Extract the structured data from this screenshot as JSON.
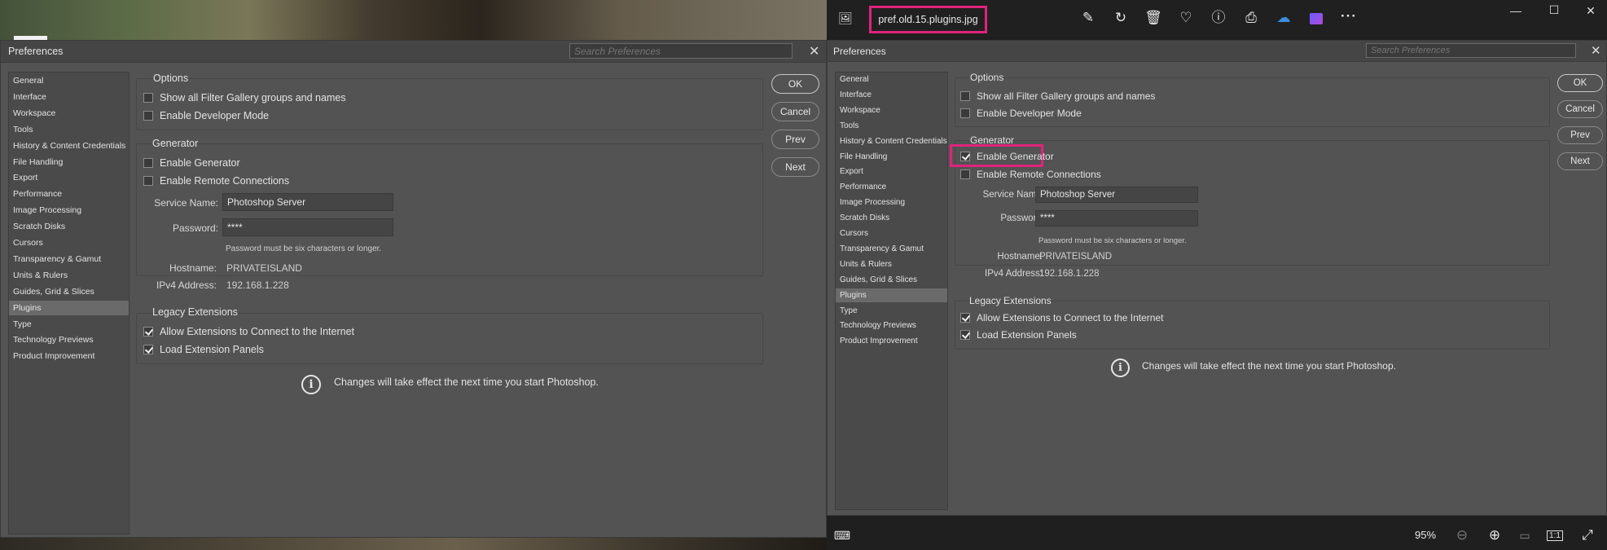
{
  "left": {
    "dialog_title": "Preferences",
    "search_placeholder": "Search Preferences",
    "close_glyph": "✕",
    "sidebar": [
      "General",
      "Interface",
      "Workspace",
      "Tools",
      "History & Content Credentials",
      "File Handling",
      "Export",
      "Performance",
      "Image Processing",
      "Scratch Disks",
      "Cursors",
      "Transparency & Gamut",
      "Units & Rulers",
      "Guides, Grid & Slices",
      "Plugins",
      "Type",
      "Technology Previews",
      "Product Improvement"
    ],
    "selected_index": 14,
    "options_title": "Options",
    "opt_filter_gallery": "Show all Filter Gallery groups and names",
    "opt_dev_mode": "Enable Developer Mode",
    "generator_title": "Generator",
    "gen_enable": "Enable Generator",
    "gen_remote": "Enable Remote Connections",
    "service_name_label": "Service Name:",
    "service_name_value": "Photoshop Server",
    "password_label": "Password:",
    "password_value": "****",
    "password_note": "Password must be six characters or longer.",
    "hostname_label": "Hostname:",
    "hostname_value": "PRIVATEISLAND",
    "ipv4_label": "IPv4 Address:",
    "ipv4_value": "192.168.1.228",
    "legacy_title": "Legacy Extensions",
    "legacy_internet": "Allow Extensions to Connect to the Internet",
    "legacy_panels": "Load Extension Panels",
    "info_text": "Changes will take effect the next time you start Photoshop.",
    "buttons": {
      "ok": "OK",
      "cancel": "Cancel",
      "prev": "Prev",
      "next": "Next"
    },
    "checked": {
      "filter_gallery": false,
      "dev_mode": false,
      "gen_enable": false,
      "gen_remote": false,
      "legacy_internet": true,
      "legacy_panels": true
    }
  },
  "right": {
    "file_name": "pref.old.15.plugins.jpg",
    "toolbar_icons": [
      "image-icon",
      "edit-icon",
      "rotate-icon",
      "delete-icon",
      "favorite-icon",
      "info-icon",
      "print-icon",
      "onedrive-icon",
      "clipchamp-icon",
      "more-icon"
    ],
    "window_controls": {
      "minimize": "—",
      "maximize": "☐",
      "close": "✕"
    },
    "zoom_value": "95%",
    "dialog_title": "Preferences",
    "search_placeholder": "Search Preferences",
    "close_glyph": "✕",
    "sidebar": [
      "General",
      "Interface",
      "Workspace",
      "Tools",
      "History & Content Credentials",
      "File Handling",
      "Export",
      "Performance",
      "Image Processing",
      "Scratch Disks",
      "Cursors",
      "Transparency & Gamut",
      "Units & Rulers",
      "Guides, Grid & Slices",
      "Plugins",
      "Type",
      "Technology Previews",
      "Product Improvement"
    ],
    "selected_index": 14,
    "options_title": "Options",
    "opt_filter_gallery": "Show all Filter Gallery groups and names",
    "opt_dev_mode": "Enable Developer Mode",
    "generator_title": "Generator",
    "gen_enable": "Enable Generator",
    "gen_remote": "Enable Remote Connections",
    "service_name_label": "Service Name:",
    "service_name_value": "Photoshop Server",
    "password_label": "Password:",
    "password_value": "****",
    "password_note": "Password must be six characters or longer.",
    "hostname_label": "Hostname:",
    "hostname_value": "PRIVATEISLAND",
    "ipv4_label": "IPv4 Address:",
    "ipv4_value": "192.168.1.228",
    "legacy_title": "Legacy Extensions",
    "legacy_internet": "Allow Extensions to Connect to the Internet",
    "legacy_panels": "Load Extension Panels",
    "info_text": "Changes will take effect the next time you start Photoshop.",
    "buttons": {
      "ok": "OK",
      "cancel": "Cancel",
      "prev": "Prev",
      "next": "Next"
    },
    "checked": {
      "filter_gallery": false,
      "dev_mode": false,
      "gen_enable": true,
      "gen_remote": false,
      "legacy_internet": true,
      "legacy_panels": true
    }
  },
  "colors": {
    "highlight": "#e0237c",
    "dialog_bg": "#535353",
    "selected_item": "#6a6a6a"
  }
}
